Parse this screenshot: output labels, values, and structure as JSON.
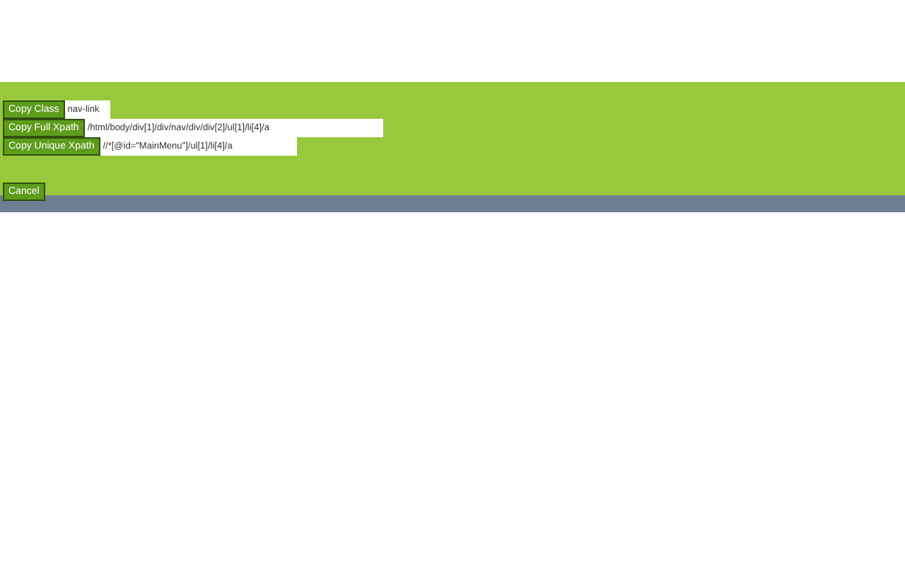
{
  "rows": [
    {
      "button": "Copy Class",
      "value": "nav-link"
    },
    {
      "button": "Copy Full Xpath",
      "value": "/html/body/div[1]/div/nav/div/div[2]/ul[1]/li[4]/a"
    },
    {
      "button": "Copy Unique Xpath",
      "value": "//*[@id=\"MainMenu\"]/ul[1]/li[4]/a"
    }
  ],
  "cancel": "Cancel"
}
